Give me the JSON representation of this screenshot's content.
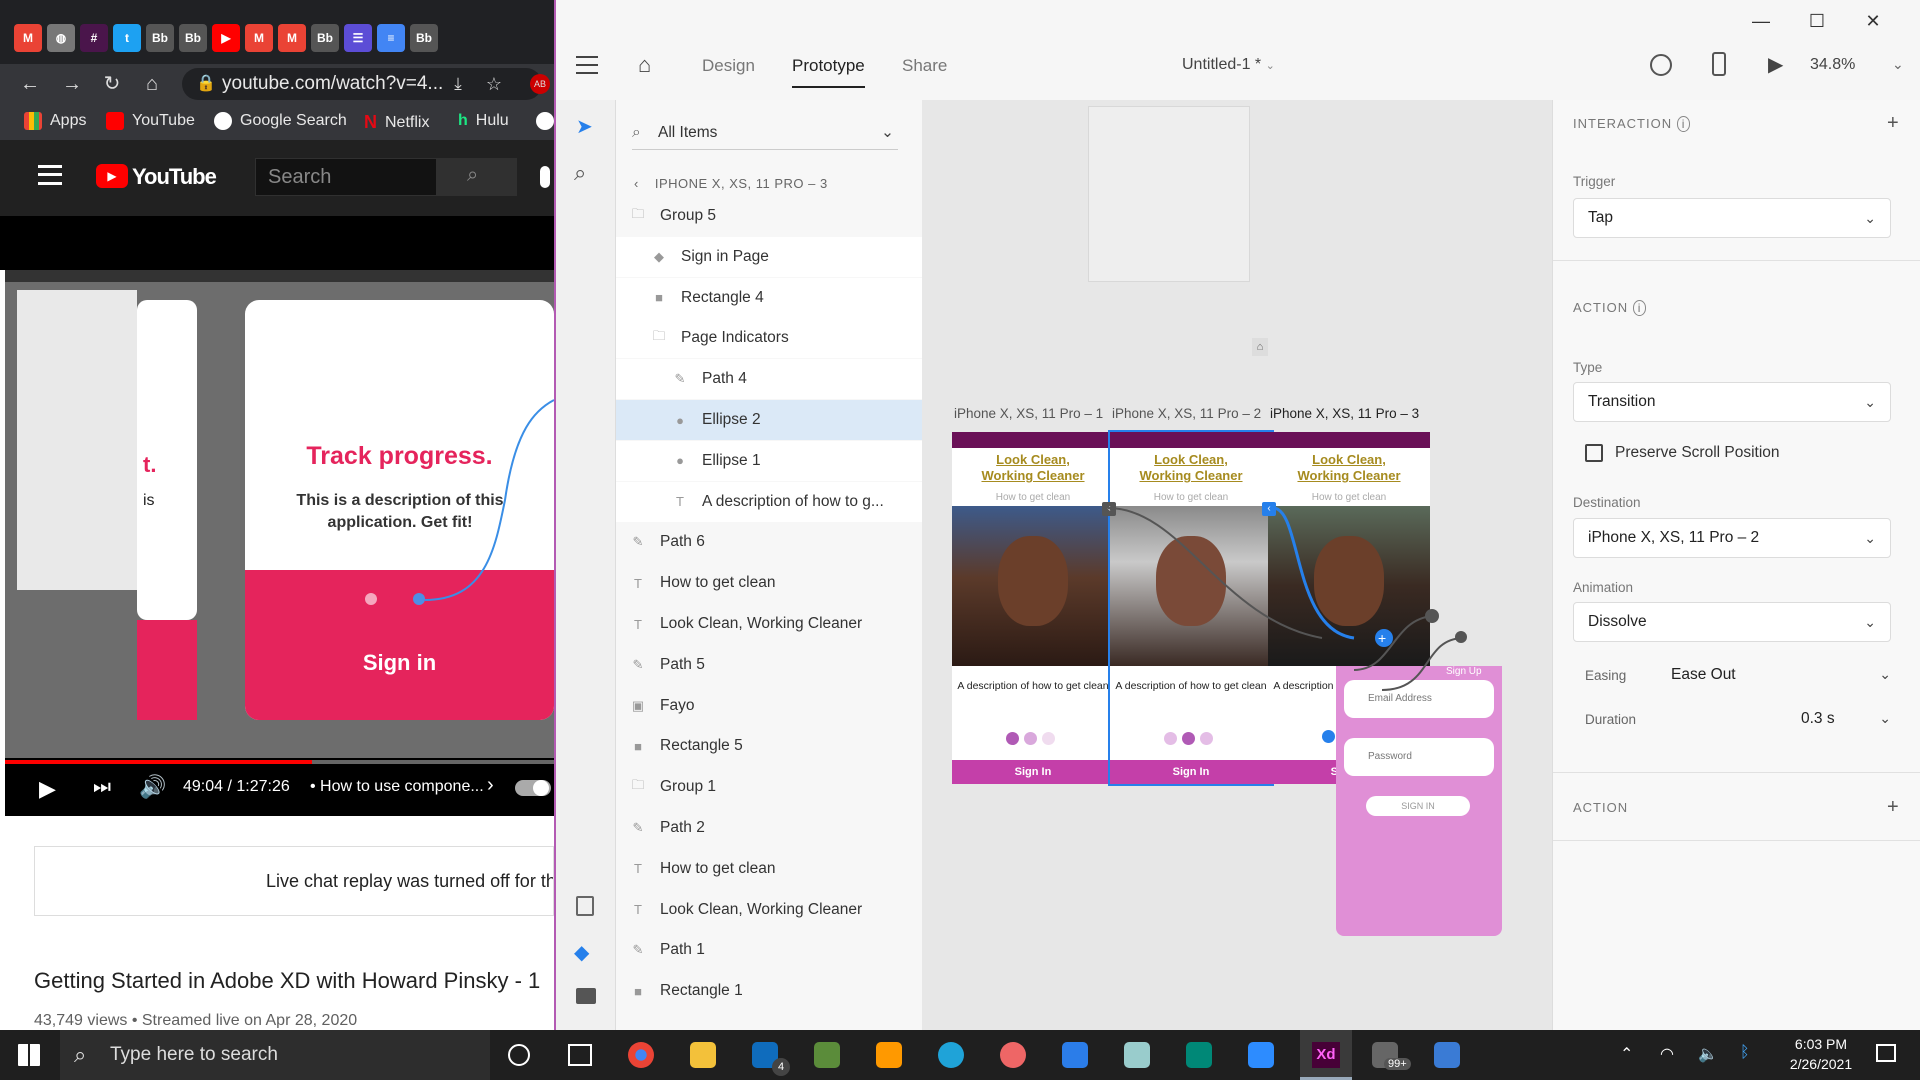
{
  "browser": {
    "url": "youtube.com/watch?v=4...",
    "bookmarks": [
      "Apps",
      "YouTube",
      "Google Search",
      "Netflix",
      "Hulu"
    ],
    "search_placeholder": "Search",
    "youtube_logo": "YouTube",
    "video": {
      "slide_heading": "Track progress.",
      "slide_text": "This is a description of this application. Get fit!",
      "slide_button": "Sign in",
      "left_fragment_1": "t.",
      "left_fragment_2": "is",
      "time": "49:04 / 1:27:26",
      "chapter": "• How to use compone...",
      "progress": 0.56
    },
    "chat_notice": "Live chat replay was turned off for thi",
    "video_title": "Getting Started in Adobe XD with Howard Pinsky - 1",
    "video_meta": "43,749 views • Streamed live on Apr 28, 2020"
  },
  "xd": {
    "tabs": [
      "Design",
      "Prototype",
      "Share"
    ],
    "active_tab": "Prototype",
    "document_title": "Untitled-1 *",
    "zoom": "34.8%",
    "layers": {
      "search_label": "All Items",
      "breadcrumb": "IPHONE X, XS, 11 PRO – 3",
      "items": [
        {
          "label": "Group 5",
          "icon": "folder-icon",
          "level": 0
        },
        {
          "label": "Sign in Page",
          "icon": "component-icon",
          "level": 1
        },
        {
          "label": "Rectangle 4",
          "icon": "rectangle-icon",
          "level": 1
        },
        {
          "label": "Page Indicators",
          "icon": "folder-icon",
          "level": 1
        },
        {
          "label": "Path 4",
          "icon": "pen-icon",
          "level": 2
        },
        {
          "label": "Ellipse 2",
          "icon": "ellipse-icon",
          "level": 2,
          "selected": true
        },
        {
          "label": "Ellipse 1",
          "icon": "ellipse-icon",
          "level": 2
        },
        {
          "label": "A description of how to g...",
          "icon": "text-icon",
          "level": 2
        },
        {
          "label": "Path 6",
          "icon": "pen-icon",
          "level": 0
        },
        {
          "label": "How to get clean",
          "icon": "text-icon",
          "level": 0
        },
        {
          "label": "Look Clean,  Working Cleaner",
          "icon": "text-icon",
          "level": 0
        },
        {
          "label": "Path 5",
          "icon": "pen-icon",
          "level": 0
        },
        {
          "label": "Fayo",
          "icon": "image-icon",
          "level": 0
        },
        {
          "label": "Rectangle 5",
          "icon": "rectangle-icon",
          "level": 0
        },
        {
          "label": "Group 1",
          "icon": "folder-icon",
          "level": 0
        },
        {
          "label": "Path 2",
          "icon": "pen-icon",
          "level": 0
        },
        {
          "label": "How to get clean",
          "icon": "text-icon",
          "level": 0
        },
        {
          "label": "Look Clean,  Working Cleaner",
          "icon": "text-icon",
          "level": 0
        },
        {
          "label": "Path 1",
          "icon": "pen-icon",
          "level": 0
        },
        {
          "label": "Rectangle 1",
          "icon": "rectangle-icon",
          "level": 0
        }
      ]
    },
    "artboards": [
      {
        "title": "iPhone X, XS, 11 Pro – 1",
        "logo_1": "Look Clean,",
        "logo_2": "Working Cleaner",
        "sub": "How to get clean",
        "desc": "A description of how to get clean",
        "button": "Sign  In"
      },
      {
        "title": "iPhone X, XS, 11 Pro – 2",
        "logo_1": "Look Clean,",
        "logo_2": "Working Cleaner",
        "sub": "How to get clean",
        "desc": "A description of how to get clean",
        "button": "Sign  In"
      },
      {
        "title": "iPhone X, XS, 11 Pro – 3",
        "logo_1": "Look Clean,",
        "logo_2": "Working Cleaner",
        "sub": "How to get clean",
        "desc": "A description of how to get clean",
        "button": "Sign  In"
      }
    ],
    "signin_overlay": {
      "signup": "Sign Up",
      "email": "Email Address",
      "password": "Password",
      "button": "SIGN IN"
    },
    "properties": {
      "interaction_header": "INTERACTION",
      "trigger_label": "Trigger",
      "trigger_value": "Tap",
      "action_header": "ACTION",
      "type_label": "Type",
      "type_value": "Transition",
      "preserve_scroll": "Preserve Scroll Position",
      "destination_label": "Destination",
      "destination_value": "iPhone X, XS, 11 Pro – 2",
      "animation_label": "Animation",
      "animation_value": "Dissolve",
      "easing_label": "Easing",
      "easing_value": "Ease Out",
      "duration_label": "Duration",
      "duration_value": "0.3 s",
      "action2_header": "ACTION"
    }
  },
  "taskbar": {
    "search_placeholder": "Type here to search",
    "time": "6:03 PM",
    "date": "2/26/2021",
    "mail_badge": "4",
    "notif_badge": "99+",
    "xd_label": "Xd"
  },
  "colors": {
    "xd_accent": "#b35ab3",
    "brand_purple": "#6a1057",
    "button_pink": "#c43fa9",
    "wire_blue": "#2680eb",
    "yt_red": "#ff0000"
  }
}
